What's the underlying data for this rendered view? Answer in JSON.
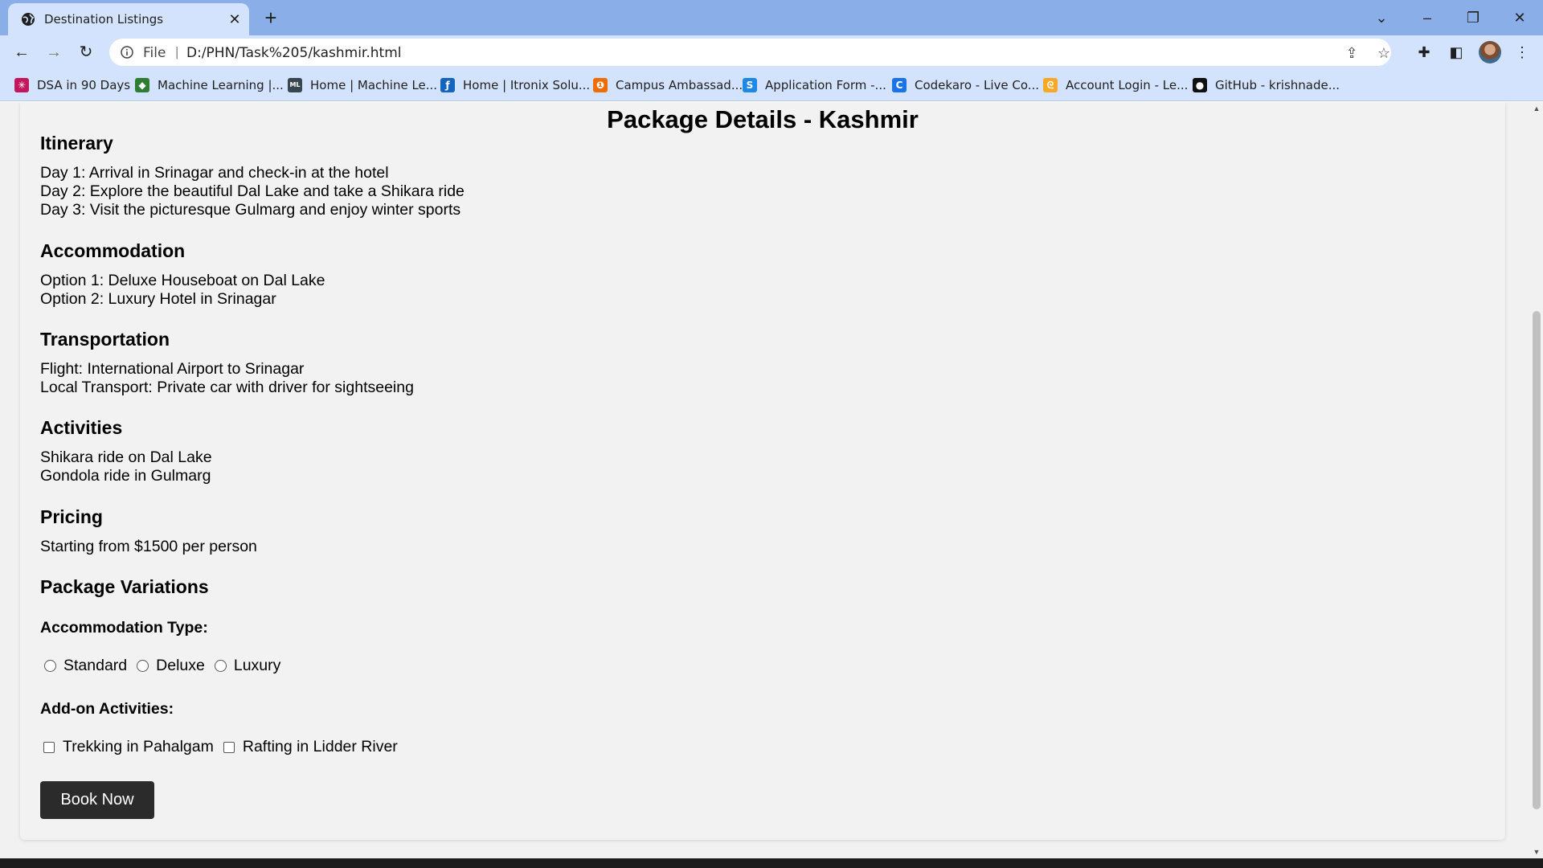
{
  "browser": {
    "tab_title": "Destination Listings",
    "new_tab_label": "+",
    "window_controls": {
      "tabs_dropdown": "⌄",
      "minimize": "–",
      "restore": "❐",
      "close": "✕"
    },
    "omnibox": {
      "scheme_label": "File",
      "separator": "|",
      "url": "D:/PHN/Task%205/kashmir.html"
    },
    "bookmarks": [
      {
        "label": "DSA in 90 Days",
        "icon": "dsa-icon",
        "color": "#c2185b"
      },
      {
        "label": "Machine Learning  |...",
        "icon": "ml-icon",
        "color": "#2e7d32"
      },
      {
        "label": "Home | Machine Le...",
        "icon": "aml-icon",
        "color": "#37474f"
      },
      {
        "label": "Home | Itronix Solu...",
        "icon": "itronix-icon",
        "color": "#1565c0"
      },
      {
        "label": "Campus Ambassad...",
        "icon": "campus-icon",
        "color": "#ef6c00"
      },
      {
        "label": "Application Form -...",
        "icon": "application-form-icon",
        "color": "#1e88e5"
      },
      {
        "label": "Codekaro - Live Co...",
        "icon": "codekaro-icon",
        "color": "#1a73e8"
      },
      {
        "label": "Account Login - Le...",
        "icon": "leetcode-icon",
        "color": "#f9a825"
      },
      {
        "label": "GitHub - krishnade...",
        "icon": "github-icon",
        "color": "#111111"
      }
    ]
  },
  "page": {
    "title": "Package Details - Kashmir",
    "itinerary": {
      "heading": "Itinerary",
      "lines": [
        "Day 1: Arrival in Srinagar and check-in at the hotel",
        "Day 2: Explore the beautiful Dal Lake and take a Shikara ride",
        "Day 3: Visit the picturesque Gulmarg and enjoy winter sports"
      ]
    },
    "accommodation": {
      "heading": "Accommodation",
      "lines": [
        "Option 1: Deluxe Houseboat on Dal Lake",
        "Option 2: Luxury Hotel in Srinagar"
      ]
    },
    "transportation": {
      "heading": "Transportation",
      "lines": [
        "Flight: International Airport to Srinagar",
        "Local Transport: Private car with driver for sightseeing"
      ]
    },
    "activities": {
      "heading": "Activities",
      "lines": [
        "Shikara ride on Dal Lake",
        "Gondola ride in Gulmarg"
      ]
    },
    "pricing": {
      "heading": "Pricing",
      "lines": [
        "Starting from $1500 per person"
      ]
    },
    "variations": {
      "heading": "Package Variations",
      "accommodation_type": {
        "label": "Accommodation Type:",
        "options": [
          {
            "label": "Standard",
            "selected": false
          },
          {
            "label": "Deluxe",
            "selected": false
          },
          {
            "label": "Luxury",
            "selected": false
          }
        ]
      },
      "addons": {
        "label": "Add-on Activities:",
        "options": [
          {
            "label": "Trekking in Pahalgam",
            "checked": false
          },
          {
            "label": "Rafting in Lidder River",
            "checked": false
          }
        ]
      }
    },
    "book_button": "Book Now"
  }
}
